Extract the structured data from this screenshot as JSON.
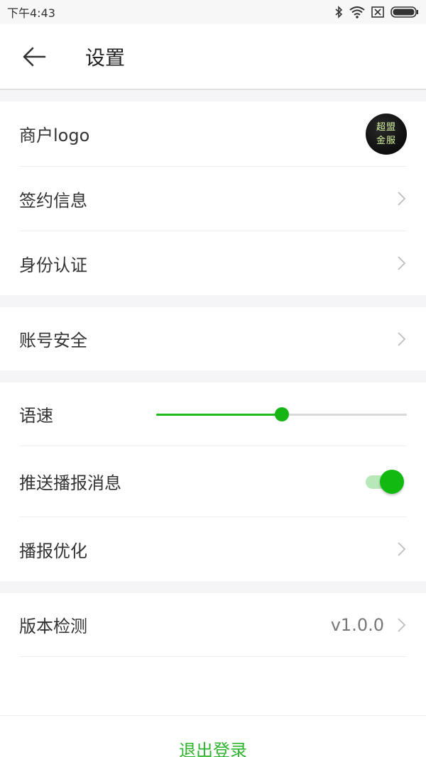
{
  "status_bar": {
    "time": "下午4:43",
    "icons": [
      "bluetooth-icon",
      "wifi-icon",
      "sim-off-icon",
      "battery-icon"
    ]
  },
  "app_bar": {
    "title": "设置",
    "back_icon": "arrow-left-icon"
  },
  "sections": {
    "account": {
      "logo": {
        "label": "商户logo",
        "badge_line1": "超盟",
        "badge_line2": "金服"
      },
      "contract": {
        "label": "签约信息"
      },
      "identity": {
        "label": "身份认证"
      }
    },
    "security": {
      "account_security": {
        "label": "账号安全"
      }
    },
    "broadcast": {
      "speech_rate": {
        "label": "语速",
        "value_fraction": 0.5
      },
      "push_broadcast": {
        "label": "推送播报消息",
        "enabled": true
      },
      "broadcast_optimize": {
        "label": "播报优化"
      }
    },
    "about": {
      "version_check": {
        "label": "版本检测",
        "value": "v1.0.0"
      }
    }
  },
  "logout": {
    "label": "退出登录"
  },
  "colors": {
    "accent": "#1db91d",
    "logout_text": "#2db52d",
    "background": "#f5f5f7"
  }
}
